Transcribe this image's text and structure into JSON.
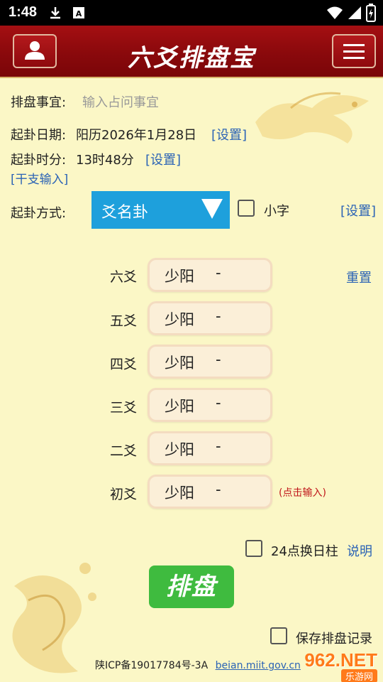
{
  "statusbar": {
    "time": "1:48"
  },
  "header": {
    "title": "六爻排盘宝"
  },
  "form": {
    "matter_label": "排盘事宜:",
    "matter_placeholder": "输入占问事宜",
    "date_label": "起卦日期:",
    "date_value": "阳历2026年1月28日",
    "date_set": "[设置]",
    "time_label": "起卦时分:",
    "time_value": "13时48分",
    "time_set": "[设置]",
    "ganzhi_link": "[干支输入]",
    "method_label": "起卦方式:",
    "method_value": "爻名卦",
    "small_text_label": "小字",
    "method_set": "[设置]"
  },
  "yao": [
    {
      "name": "六爻",
      "value": "少阳",
      "mark": "-"
    },
    {
      "name": "五爻",
      "value": "少阳",
      "mark": "-"
    },
    {
      "name": "四爻",
      "value": "少阳",
      "mark": "-"
    },
    {
      "name": "三爻",
      "value": "少阳",
      "mark": "-"
    },
    {
      "name": "二爻",
      "value": "少阳",
      "mark": "-"
    },
    {
      "name": "初爻",
      "value": "少阳",
      "mark": "-"
    }
  ],
  "reset_label": "重置",
  "hint_label": "(点击输入)",
  "options": {
    "day_change_label": "24点换日柱",
    "explain_label": "说明",
    "save_label": "保存排盘记录"
  },
  "paipan_button": "排盘",
  "footer": {
    "icp": "陕ICP备19017784号-3A",
    "domain": "beian.miit.gov.cn"
  },
  "watermark": {
    "site": "962.NET",
    "sub": "乐游网"
  },
  "colors": {
    "header_red": "#8a090c",
    "background": "#fbf7c6",
    "link_blue": "#2b63b5",
    "select_blue": "#1ea0dc",
    "button_green": "#3fbb3f",
    "hint_red": "#c0161a"
  }
}
